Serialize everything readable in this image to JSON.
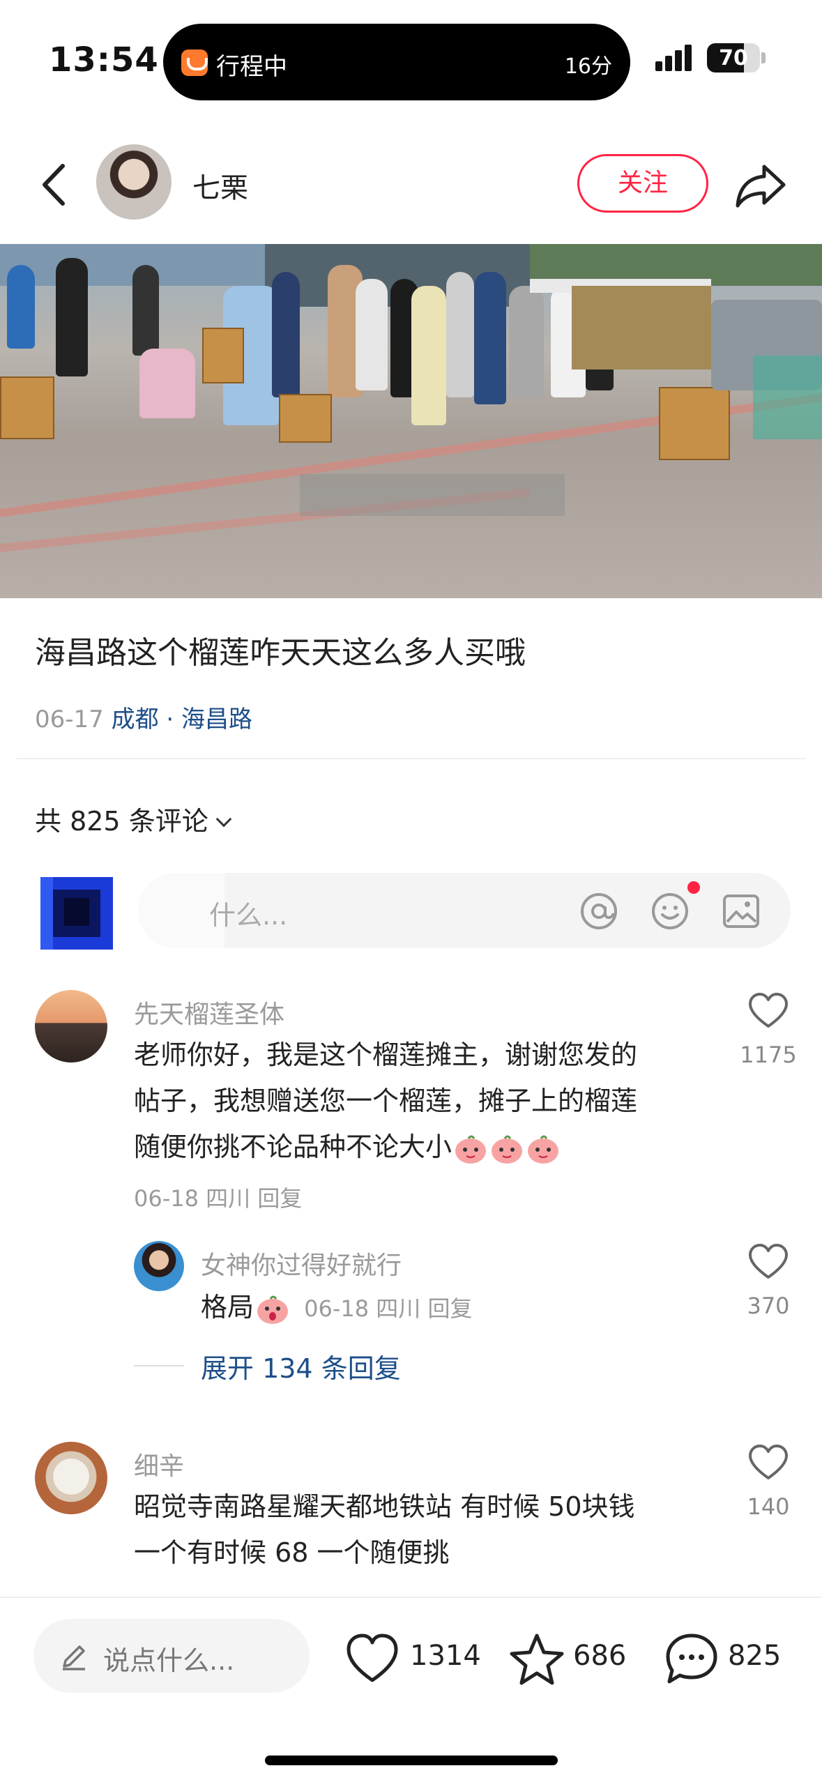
{
  "status_bar": {
    "time": "13:54",
    "live_activity": {
      "app_icon": "didi-icon",
      "label": "行程中",
      "eta": "16分"
    },
    "battery": {
      "percent": "70",
      "level": 0.7
    },
    "signal_bars": 4
  },
  "header": {
    "author_name": "七栗",
    "follow_label": "关注",
    "icons": {
      "back": "back-arrow-icon",
      "share": "share-icon"
    }
  },
  "post": {
    "title": "海昌路这个榴莲咋天天这么多人买哦",
    "date": "06-17",
    "location": "成都 · 海昌路"
  },
  "comments_section": {
    "count_label": "共 825 条评论",
    "input_placeholder": "说点什么...",
    "input_visible_text": "什么...",
    "input_icons": [
      "at-icon",
      "emoji-icon",
      "image-icon"
    ]
  },
  "comments": [
    {
      "name": "先天榴莲圣体",
      "lines": [
        "老师你好，我是这个榴莲摊主，谢谢您发的",
        "帖子，我想赠送您一个榴莲，摊子上的榴莲",
        "随便你挑不论品种不论大小"
      ],
      "meta": "06-18 四川 回复",
      "likes": "1175",
      "replies": [
        {
          "name": "女神你过得好就行",
          "text": "格局",
          "meta": "06-18 四川 回复",
          "likes": "370"
        }
      ],
      "expand_label": "展开 134 条回复"
    },
    {
      "name": "细辛",
      "lines": [
        "昭觉寺南路星耀天都地铁站 有时候 50块钱",
        "一个有时候 68 一个随便挑"
      ],
      "likes": "140"
    }
  ],
  "bottom_bar": {
    "say_placeholder": "说点什么...",
    "likes": "1314",
    "favorites": "686",
    "comments": "825"
  },
  "colors": {
    "accent": "#ff2442",
    "link": "#1d4e89",
    "muted": "#9a9a9a"
  }
}
